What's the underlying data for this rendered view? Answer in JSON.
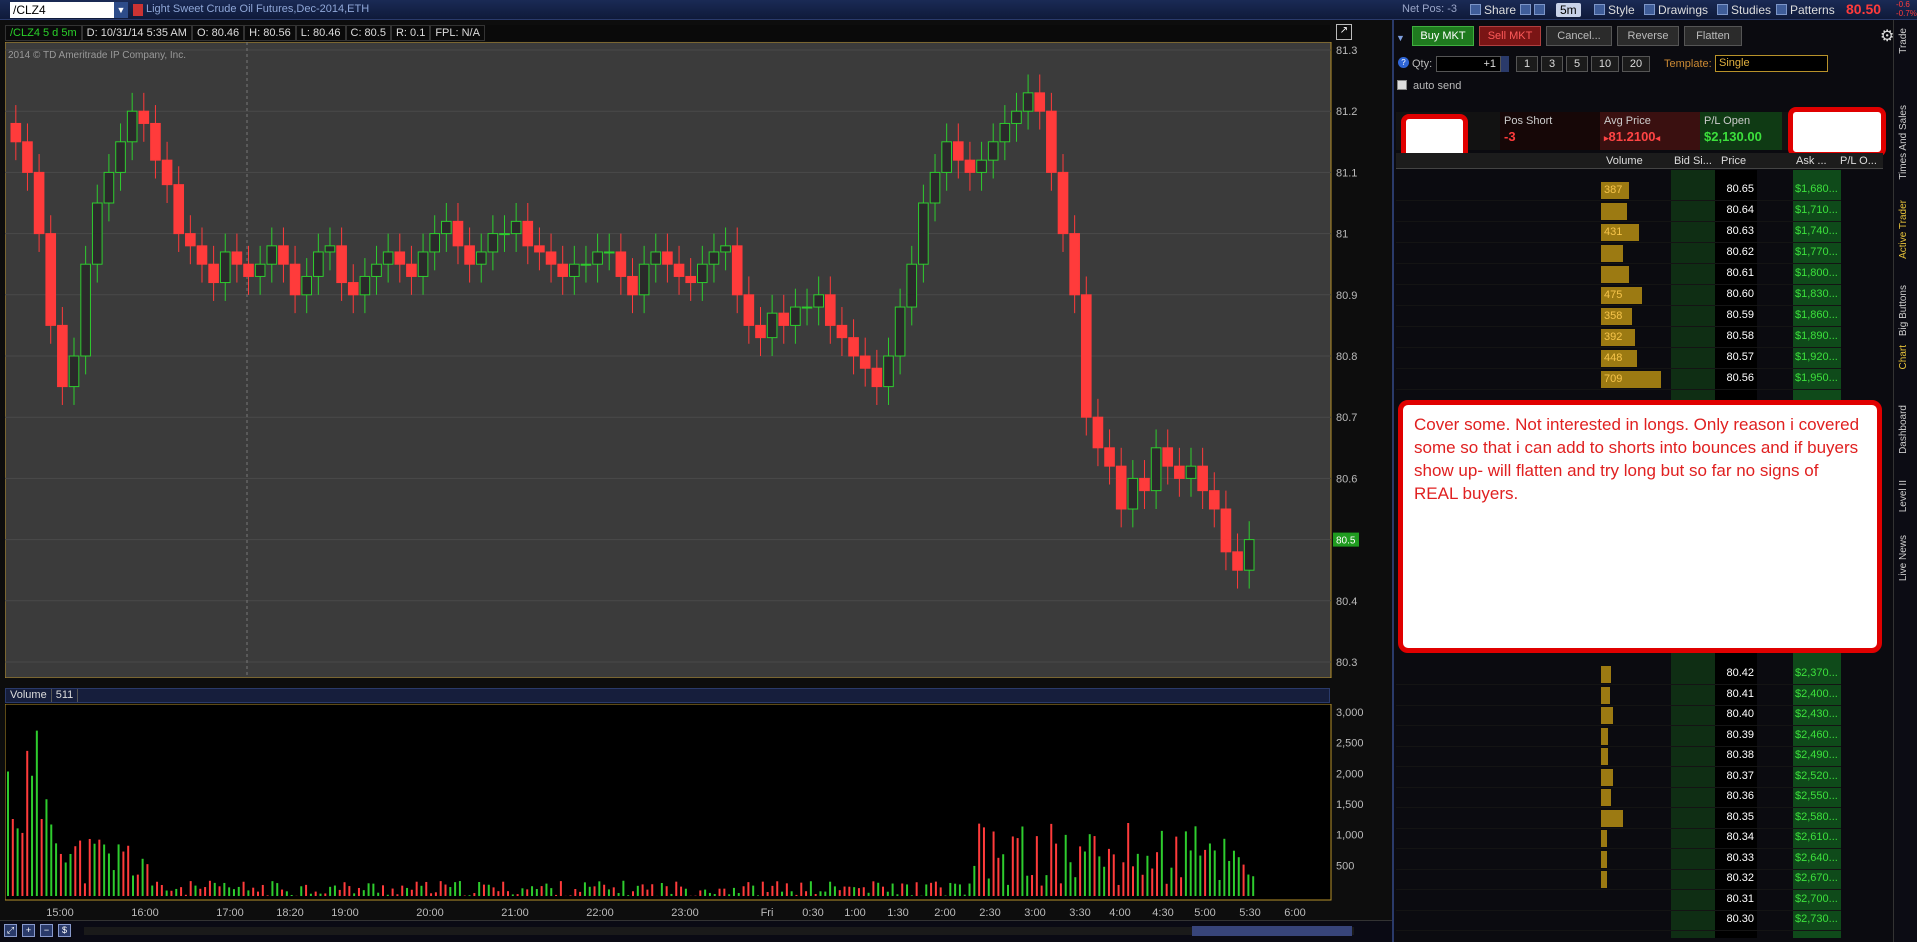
{
  "header": {
    "symbol": "/CLZ4",
    "description": "Light Sweet Crude Oil Futures,Dec-2014,ETH",
    "net_pos": "Net Pos: -3",
    "buttons": {
      "share": "Share",
      "timeframe": "5m",
      "style": "Style",
      "drawings": "Drawings",
      "studies": "Studies",
      "patterns": "Patterns"
    },
    "last_price": "80.50",
    "change_1": "-0.6",
    "change_2": "-0.7%"
  },
  "chart": {
    "info": {
      "study": "/CLZ4 5 d 5m",
      "date": "D: 10/31/14 5:35 AM",
      "open": "O: 80.46",
      "high": "H: 80.56",
      "low": "L: 80.46",
      "close": "C: 80.5",
      "range": "R: 0.1",
      "fpl": "FPL: N/A"
    },
    "copyright": "2014 © TD Ameritrade IP Company, Inc.",
    "volume_header": {
      "label": "Volume",
      "value": "511"
    },
    "current_price_tag": "80.5"
  },
  "chart_data": {
    "type": "candlestick",
    "title": "",
    "price_axis": {
      "min": 80.3,
      "max": 81.3,
      "ticks": [
        "80.3",
        "80.4",
        "80.5",
        "80.6",
        "80.7",
        "80.8",
        "80.9",
        "81",
        "81.1",
        "81.2",
        "81.3"
      ]
    },
    "volume_axis": {
      "min": 0,
      "max": 3000,
      "ticks": [
        "500",
        "1,000",
        "1,500",
        "2,000",
        "2,500",
        "3,000"
      ]
    },
    "time_ticks": [
      "15:00",
      "16:00",
      "17:00",
      "18:20",
      "19:00",
      "20:00",
      "21:00",
      "22:00",
      "23:00",
      "Fri",
      "0:30",
      "1:00",
      "1:30",
      "2:00",
      "2:30",
      "3:00",
      "3:30",
      "4:00",
      "4:30",
      "5:00",
      "5:30",
      "6:00"
    ],
    "close_series": [
      81.15,
      81.1,
      81.0,
      80.85,
      80.75,
      80.8,
      80.95,
      81.05,
      81.1,
      81.15,
      81.2,
      81.18,
      81.12,
      81.08,
      81.0,
      80.98,
      80.95,
      80.92,
      80.97,
      80.95,
      80.93,
      80.95,
      80.98,
      80.95,
      80.9,
      80.93,
      80.97,
      80.98,
      80.92,
      80.9,
      80.93,
      80.95,
      80.97,
      80.95,
      80.93,
      80.97,
      81.0,
      81.02,
      80.98,
      80.95,
      80.97,
      81.0,
      81.0,
      81.02,
      80.98,
      80.97,
      80.95,
      80.93,
      80.95,
      80.95,
      80.97,
      80.97,
      80.93,
      80.9,
      80.95,
      80.97,
      80.95,
      80.93,
      80.92,
      80.95,
      80.97,
      80.98,
      80.9,
      80.85,
      80.83,
      80.87,
      80.85,
      80.88,
      80.88,
      80.9,
      80.85,
      80.83,
      80.8,
      80.78,
      80.75,
      80.8,
      80.88,
      80.95,
      81.05,
      81.1,
      81.15,
      81.12,
      81.1,
      81.12,
      81.15,
      81.18,
      81.2,
      81.23,
      81.2,
      81.1,
      81.0,
      80.9,
      80.7,
      80.65,
      80.62,
      80.55,
      80.6,
      80.58,
      80.65,
      80.62,
      80.6,
      80.62,
      80.58,
      80.55,
      80.48,
      80.45,
      80.5
    ]
  },
  "order_entry": {
    "buy": "Buy MKT",
    "sell": "Sell MKT",
    "cancel": "Cancel...",
    "reverse": "Reverse",
    "flatten": "Flatten",
    "qty_label": "Qty:",
    "qty_value": "+1",
    "qty_buttons": [
      "1",
      "3",
      "5",
      "10",
      "20"
    ],
    "template_label": "Template:",
    "template_value": "Single",
    "auto_send": "auto send"
  },
  "position": {
    "pos_label": "Pos Short",
    "pos_value": "-3",
    "avg_label": "Avg Price",
    "avg_value": "81.2100",
    "pl_label": "P/L Open",
    "pl_value": "$2,130.00"
  },
  "ladder": {
    "headers": {
      "volume": "Volume",
      "bid": "Bid Si...",
      "price": "Price",
      "ask": "Ask ...",
      "pl": "P/L O..."
    },
    "top_rows": [
      {
        "vol": "387",
        "vw": 30,
        "price": "80.65",
        "pl": "$1,680..."
      },
      {
        "vol": "",
        "vw": 28,
        "price": "80.64",
        "pl": "$1,710..."
      },
      {
        "vol": "431",
        "vw": 42,
        "price": "80.63",
        "pl": "$1,740..."
      },
      {
        "vol": "",
        "vw": 22,
        "price": "80.62",
        "pl": "$1,770..."
      },
      {
        "vol": "",
        "vw": 30,
        "price": "80.61",
        "pl": "$1,800..."
      },
      {
        "vol": "475",
        "vw": 46,
        "price": "80.60",
        "pl": "$1,830..."
      },
      {
        "vol": "358",
        "vw": 34,
        "price": "80.59",
        "pl": "$1,860..."
      },
      {
        "vol": "392",
        "vw": 38,
        "price": "80.58",
        "pl": "$1,890..."
      },
      {
        "vol": "448",
        "vw": 40,
        "price": "80.57",
        "pl": "$1,920..."
      },
      {
        "vol": "709",
        "vw": 70,
        "price": "80.56",
        "pl": "$1,950..."
      }
    ],
    "bottom_rows": [
      {
        "vol": "",
        "vw": 8,
        "price": "80.42",
        "pl": "$2,370..."
      },
      {
        "vol": "",
        "vw": 6,
        "price": "80.41",
        "pl": "$2,400..."
      },
      {
        "vol": "",
        "vw": 10,
        "price": "80.40",
        "pl": "$2,430..."
      },
      {
        "vol": "",
        "vw": 4,
        "price": "80.39",
        "pl": "$2,460..."
      },
      {
        "vol": "",
        "vw": 4,
        "price": "80.38",
        "pl": "$2,490..."
      },
      {
        "vol": "",
        "vw": 10,
        "price": "80.37",
        "pl": "$2,520..."
      },
      {
        "vol": "",
        "vw": 8,
        "price": "80.36",
        "pl": "$2,550..."
      },
      {
        "vol": "",
        "vw": 22,
        "price": "80.35",
        "pl": "$2,580..."
      },
      {
        "vol": "",
        "vw": 2,
        "price": "80.34",
        "pl": "$2,610..."
      },
      {
        "vol": "",
        "vw": 2,
        "price": "80.33",
        "pl": "$2,640..."
      },
      {
        "vol": "",
        "vw": 2,
        "price": "80.32",
        "pl": "$2,670..."
      },
      {
        "vol": "",
        "vw": 0,
        "price": "80.31",
        "pl": "$2,700..."
      },
      {
        "vol": "",
        "vw": 0,
        "price": "80.30",
        "pl": "$2,730..."
      }
    ]
  },
  "note": "Cover some. Not interested in longs. Only reason i covered some so that i can add to shorts into bounces and if buyers show up- will flatten and try long but so far no signs of REAL buyers.",
  "side_tabs": [
    "Trade",
    "Times And Sales",
    "Active Trader",
    "Big Buttons",
    "Chart",
    "Dashboard",
    "Level II",
    "Live News"
  ],
  "colors": {
    "up": "#2ecc2e",
    "down": "#ff3b3b",
    "accent": "#e6c23a"
  }
}
